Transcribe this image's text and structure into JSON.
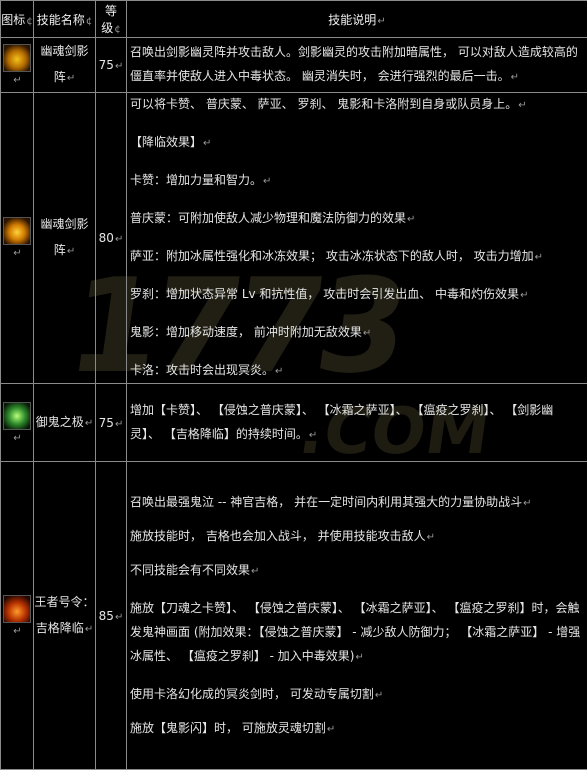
{
  "watermark": {
    "text": "1773",
    "sub": ".COM"
  },
  "header": {
    "icon": "图标",
    "name": "技能名称",
    "level": "等级",
    "desc": "技能说明"
  },
  "rows": [
    {
      "icon": "sword-ghost-icon",
      "name_lines": [
        "幽魂剑影",
        "阵"
      ],
      "level": "75",
      "desc": [
        "召唤出剑影幽灵阵并攻击敌人。剑影幽灵的攻击附加暗属性， 可以对敌人造成较高的僵直率并使敌人进入中毒状态。 幽灵消失时， 会进行强烈的最后一击。"
      ]
    },
    {
      "icon": "ghost-flame-icon",
      "name_lines": [
        "幽魂剑影",
        "阵"
      ],
      "level": "80",
      "desc": [
        "可以将卡赞、 普庆蒙、 萨亚、 罗刹、 鬼影和卡洛附到自身或队员身上。",
        "【降临效果】",
        "卡赞：增加力量和智力。",
        "普庆蒙：可附加使敌人减少物理和魔法防御力的效果",
        "萨亚：附加冰属性强化和冰冻效果； 攻击冰冻状态下的敌人时， 攻击力增加",
        "罗刹：增加状态异常 Lv 和抗性值， 攻击时会引发出血、 中毒和灼伤效果",
        "鬼影：增加移动速度， 前冲时附加无敌效果",
        "卡洛：攻击时会出现冥炎。"
      ]
    },
    {
      "icon": "green-spirit-icon",
      "name_lines": [
        "御鬼之极"
      ],
      "level": "75",
      "desc": [
        "增加【卡赞】、 【侵蚀之普庆蒙】、 【冰霜之萨亚】、 【瘟疫之罗刹】、 【剑影幽灵】、 【吉格降临】的持续时间。"
      ]
    },
    {
      "icon": "king-fire-icon",
      "name_lines": [
        "王者号令：",
        "吉格降临"
      ],
      "level": "85",
      "desc": [
        "召唤出最强鬼泣 -- 神官吉格， 并在一定时间内利用其强大的力量协助战斗",
        "施放技能时， 吉格也会加入战斗， 并使用技能攻击敌人",
        "不同技能会有不同效果",
        "施放【刀魂之卡赞】、 【侵蚀之普庆蒙】、 【冰霜之萨亚】、 【瘟疫之罗刹】时，会触发鬼神画面 (附加效果：【侵蚀之普庆蒙】 - 减少敌人防御力； 【冰霜之萨亚】 - 增强冰属性、 【瘟疫之罗刹】 - 加入中毒效果)",
        "使用卡洛幻化成的冥炎剑时， 可发动专属切割",
        "施放【鬼影闪】时， 可施放灵魂切割"
      ]
    }
  ]
}
